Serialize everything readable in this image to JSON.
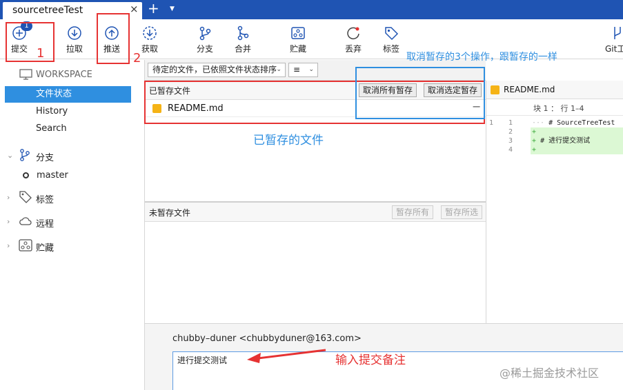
{
  "tab": {
    "title": "sourcetreeTest",
    "close": "×",
    "add": "+",
    "menu": "▼"
  },
  "toolbar": {
    "commit": "提交",
    "commit_badge": "1",
    "pull": "拉取",
    "push": "推送",
    "fetch": "获取",
    "branch": "分支",
    "merge": "合并",
    "stash": "贮藏",
    "discard": "丢弃",
    "tag": "标签",
    "git_flow": "Git工"
  },
  "sidebar": {
    "workspace": "WORKSPACE",
    "items": [
      "文件状态",
      "History",
      "Search"
    ],
    "groups": {
      "branches": "分支",
      "tags": "标签",
      "remotes": "远程",
      "stashes": "贮藏"
    },
    "branch_master": "master"
  },
  "filter": {
    "sort_label": "待定的文件，已依照文件状态排序",
    "view_mode": "≡"
  },
  "staged": {
    "title": "已暂存文件",
    "unstage_all": "取消所有暂存",
    "unstage_selected": "取消选定暂存",
    "file": "README.md",
    "minus": "−"
  },
  "unstaged": {
    "title": "未暂存文件",
    "stage_all": "暂存所有",
    "stage_selected": "暂存所选"
  },
  "diff": {
    "file": "README.md",
    "hunk": "块 1 ： 行 1–4",
    "lines": [
      {
        "old": "1",
        "new": "1",
        "type": "ctx",
        "sign": "···",
        "text": "# SourceTreeTest"
      },
      {
        "old": "",
        "new": "2",
        "type": "add",
        "sign": "+",
        "text": ""
      },
      {
        "old": "",
        "new": "3",
        "type": "add",
        "sign": "+",
        "text": "# 进行提交测试"
      },
      {
        "old": "",
        "new": "4",
        "type": "add",
        "sign": "+",
        "text": ""
      }
    ]
  },
  "commit": {
    "author": "chubby–duner <chubbyduner@163.com>",
    "message": "进行提交测试"
  },
  "annotations": {
    "num1": "1",
    "num2": "2",
    "unstage_note": "取消暂存的3个操作，跟暂存的一样",
    "staged_note": "已暂存的文件",
    "input_note": "输入提交备注",
    "watermark": "@稀土掘金技术社区"
  },
  "colors": {
    "accent": "#1f54b3",
    "selection": "#2f8fe0",
    "annotation_red": "#e63232",
    "annotation_blue": "#2f8fe0"
  }
}
